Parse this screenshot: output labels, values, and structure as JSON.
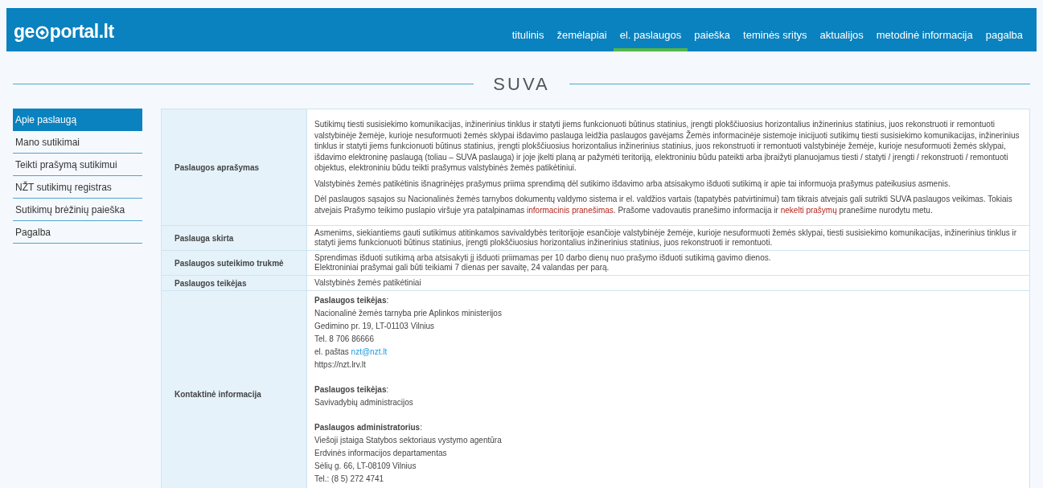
{
  "logo": {
    "before": "ge",
    "after": "portal.lt"
  },
  "nav": [
    {
      "label": "titulinis",
      "selected": false
    },
    {
      "label": "žemėlapiai",
      "selected": false
    },
    {
      "label": "el. paslaugos",
      "selected": true
    },
    {
      "label": "paieška",
      "selected": false
    },
    {
      "label": "teminės sritys",
      "selected": false
    },
    {
      "label": "aktualijos",
      "selected": false
    },
    {
      "label": "metodinė informacija",
      "selected": false
    },
    {
      "label": "pagalba",
      "selected": false
    }
  ],
  "page_title": "SUVA",
  "sidebar": [
    {
      "label": "Apie paslaugą",
      "selected": true
    },
    {
      "label": "Mano sutikimai",
      "selected": false
    },
    {
      "label": "Teikti prašymą sutikimui",
      "selected": false
    },
    {
      "label": "NŽT sutikimų registras",
      "selected": false
    },
    {
      "label": "Sutikimų brėžinių paieška",
      "selected": false
    },
    {
      "label": "Pagalba",
      "selected": false
    }
  ],
  "rows": [
    {
      "label": "Paslaugos aprašymas",
      "kind": "paragraphs",
      "paragraphs": [
        [
          {
            "text": "Sutikimų tiesti susisiekimo komunikacijas, inžinerinius tinklus ir statyti jiems funkcionuoti būtinus statinius, įrengti plokščiuosius horizontalius inžinerinius statinius, juos rekonstruoti ir remontuoti valstybinėje žemėje, kurioje nesuformuoti žemės sklypai išdavimo paslauga leidžia paslaugos gavėjams Žemės informacinėje sistemoje inicijuoti sutikimų tiesti susisiekimo komunikacijas, inžinerinius tinklus ir statyti jiems funkcionuoti būtinus statinius, įrengti plokščiuosius horizontalius inžinerinius statinius, juos rekonstruoti ir remontuoti valstybinėje žemėje, kurioje nesuformuoti žemės sklypai, išdavimo elektroninę paslaugą (toliau – SUVA paslauga) ir joje įkelti planą ar pažymėti teritoriją, elektroniniu būdu pateikti arba įbraižyti planuojamus tiesti / statyti / įrengti / rekonstruoti / remontuoti objektus, elektroniniu būdu teikti prašymus valstybinės žemės patikėtiniui.",
            "kind": "text"
          }
        ],
        [
          {
            "text": "Valstybinės žemės patikėtinis išnagrinėjęs prašymus priima sprendimą dėl sutikimo išdavimo arba atsisakymo išduoti sutikimą ir apie tai informuoja prašymus pateikusius asmenis.",
            "kind": "text"
          }
        ],
        [
          {
            "text": "Dėl paslaugos sąsajos su Nacionalinės žemės tarnybos dokumentų valdymo sistema ir el. valdžios vartais (tapatybės patvirtinimui) tam tikrais atvejais gali sutrikti SUVA paslaugos veikimas. Tokiais atvejais Prašymo teikimo puslapio viršuje yra patalpinamas ",
            "kind": "text"
          },
          {
            "text": "informacinis pranešimas",
            "kind": "link"
          },
          {
            "text": ". Prašome vadovautis pranešimo informacija ir ",
            "kind": "text"
          },
          {
            "text": "nekelti prašymų",
            "kind": "link"
          },
          {
            "text": " pranešime nurodytu metu.",
            "kind": "text"
          }
        ]
      ]
    },
    {
      "label": "Paslauga skirta",
      "kind": "lines",
      "lines": [
        "Asmenims, siekiantiems gauti sutikimus atitinkamos savivaldybės teritorijoje esančioje valstybinėje žemėje, kurioje nesuformuoti žemės sklypai, tiesti susisiekimo komunikacijas, inžinerinius tinklus ir statyti jiems funkcionuoti būtinus statinius, įrengti plokščiuosius horizontalius inžinerinius statinius, juos rekonstruoti ir remontuoti."
      ]
    },
    {
      "label": "Paslaugos suteikimo trukmė",
      "kind": "lines",
      "lines": [
        "Sprendimas išduoti sutikimą arba atsisakyti jį išduoti priimamas per 10 darbo dienų nuo prašymo išduoti sutikimą gavimo dienos.",
        "Elektroniniai prašymai gali būti teikiami 7 dienas per savaitę, 24 valandas per parą."
      ]
    },
    {
      "label": "Paslaugos teikėjas",
      "kind": "lines",
      "lines": [
        "Valstybinės žemės patikėtiniai"
      ]
    },
    {
      "label": "Kontaktinė informacija",
      "kind": "contacts",
      "blocks": [
        [
          {
            "kind": "heading",
            "text": "**Paslaugos teikėjas**:"
          },
          {
            "kind": "text",
            "text": "Nacionalinė žemės tarnyba prie Aplinkos ministerijos"
          },
          {
            "kind": "text",
            "text": "Gedimino pr. 19, LT-01103 Vilnius"
          },
          {
            "kind": "text",
            "text": "Tel. 8 706 86666"
          },
          {
            "kind": "email",
            "text": "el. paštas ",
            "link": "nzt@nzt.lt"
          },
          {
            "kind": "text",
            "text": "https://nzt.lrv.lt"
          }
        ],
        [
          {
            "kind": "heading",
            "text": "**Paslaugos teikėjas**:"
          },
          {
            "kind": "text",
            "text": "Savivadybių administracijos"
          }
        ],
        [
          {
            "kind": "heading",
            "text": "**Paslaugos administratorius**:"
          },
          {
            "kind": "text",
            "text": "Viešoji įstaiga Statybos sektoriaus vystymo agentūra"
          },
          {
            "kind": "text",
            "text": "Erdvinės informacijos departamentas"
          },
          {
            "kind": "text",
            "text": "Sėlių g. 66, LT-08109 Vilnius"
          },
          {
            "kind": "text",
            "text": "Tel.: (8 5) 272 4741"
          }
        ]
      ]
    }
  ]
}
